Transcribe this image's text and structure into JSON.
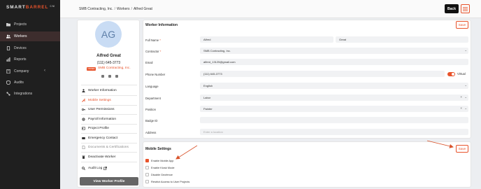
{
  "app": {
    "logo_main": "SMART",
    "logo_accent": "BARREL",
    "logo_suffix": "CM"
  },
  "sidebar": {
    "items": [
      {
        "label": "Projects",
        "icon": "folder-icon"
      },
      {
        "label": "Workers",
        "icon": "people-icon",
        "active": true
      },
      {
        "label": "Devices",
        "icon": "device-icon"
      },
      {
        "label": "Reports",
        "icon": "report-icon"
      },
      {
        "label": "Company",
        "icon": "building-icon",
        "chevron": "‹"
      },
      {
        "label": "Audits",
        "icon": "audit-icon"
      },
      {
        "label": "Integrations",
        "icon": "integration-icon"
      }
    ]
  },
  "header": {
    "breadcrumb": [
      "SMB Contracting, Inc.",
      "Workers",
      "Alfred Great"
    ],
    "back_label": "Back"
  },
  "profile": {
    "initials": "AG",
    "name": "Alfred Great",
    "phone": "(111) 645-3773",
    "badge": "OWNER",
    "company": "SMB Contracting, Inc.",
    "menu": [
      {
        "label": "Worker Information",
        "icon": "person-icon"
      },
      {
        "label": "Mobile Settings",
        "icon": "wrench-icon",
        "active": true
      },
      {
        "label": "User Permissions",
        "icon": "key-icon"
      },
      {
        "label": "Payroll Information",
        "icon": "gear-icon"
      },
      {
        "label": "Project Profile",
        "icon": "id-card-icon"
      },
      {
        "label": "Emergency Contact",
        "icon": "phone-icon"
      },
      {
        "label": "Documents & Certifications",
        "icon": "document-icon",
        "muted": true
      },
      {
        "label": "Deactivate Worker",
        "icon": "trash-icon"
      },
      {
        "label": "Audit Log",
        "icon": "search-icon",
        "extra": "external-link-icon"
      }
    ],
    "view_button": "View Worker Profile"
  },
  "worker_info": {
    "title": "Worker Information",
    "save_label": "Save",
    "fields": {
      "full_name": {
        "label": "Full Name",
        "first": "Alfred",
        "last": "Great"
      },
      "contractor": {
        "label": "Contractor",
        "value": "SMB Contracting, Inc."
      },
      "email": {
        "label": "Email",
        "value": "alfred_13125@gmail.com"
      },
      "phone": {
        "label": "Phone Number",
        "value": "(111) 645-3773",
        "toggle_label": "Virtual"
      },
      "language": {
        "label": "Language",
        "value": "English"
      },
      "department": {
        "label": "Department",
        "value": "Labor"
      },
      "position": {
        "label": "Position",
        "value": "Painter"
      },
      "badge_id": {
        "label": "Badge ID",
        "value": ""
      },
      "address": {
        "label": "Address",
        "placeholder": "Enter a location"
      }
    }
  },
  "mobile_settings": {
    "title": "Mobile Settings",
    "save_label": "Save",
    "options": [
      {
        "label": "Enable Mobile App",
        "checked": true
      },
      {
        "label": "Enable Kiosk Mode",
        "checked": false
      },
      {
        "label": "Disable Geofence",
        "checked": false
      },
      {
        "label": "Restrict Access to User Projects",
        "checked": false
      }
    ]
  },
  "colors": {
    "accent": "#e8532b",
    "sidebar": "#1f1f1f",
    "annotation": "#d9532b"
  }
}
